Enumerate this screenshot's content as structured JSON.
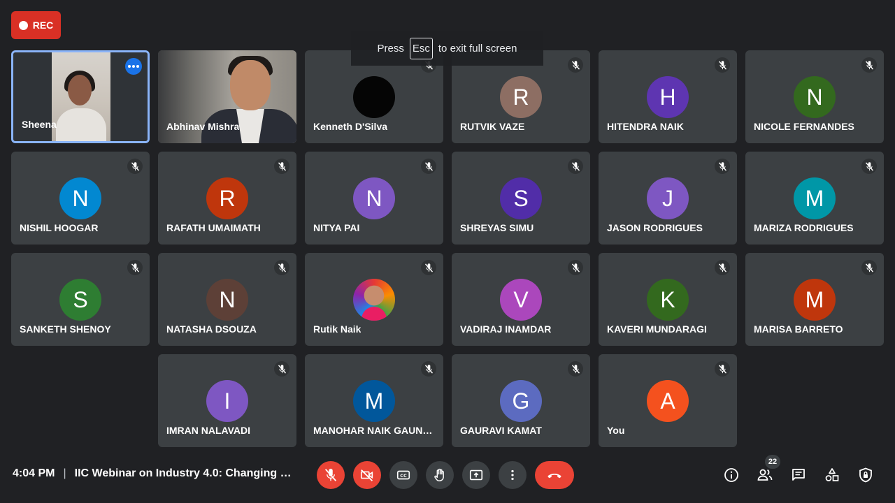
{
  "recording": {
    "label": "REC"
  },
  "toast": {
    "prefix": "Press",
    "key": "Esc",
    "suffix": "to exit full screen"
  },
  "participants": [
    {
      "name": "Sheena",
      "type": "video",
      "active": true
    },
    {
      "name": "Abhinav Mishra",
      "type": "video"
    },
    {
      "name": "Kenneth D'Silva",
      "initial": "",
      "color": "#050505",
      "muted": true
    },
    {
      "name": "RUTVIK VAZE",
      "initial": "R",
      "color": "#8d6e63",
      "muted": true
    },
    {
      "name": "HITENDRA NAIK",
      "initial": "H",
      "color": "#5e35b1",
      "muted": true
    },
    {
      "name": "NICOLE FERNANDES",
      "initial": "N",
      "color": "#33691e",
      "muted": true
    },
    {
      "name": "NISHIL HOOGAR",
      "initial": "N",
      "color": "#0288d1",
      "muted": true
    },
    {
      "name": "RAFATH UMAIMATH",
      "initial": "R",
      "color": "#bf360c",
      "muted": true
    },
    {
      "name": "NITYA PAI",
      "initial": "N",
      "color": "#7e57c2",
      "muted": true
    },
    {
      "name": "SHREYAS SIMU",
      "initial": "S",
      "color": "#512da8",
      "muted": true
    },
    {
      "name": "JASON RODRIGUES",
      "initial": "J",
      "color": "#7e57c2",
      "muted": true
    },
    {
      "name": "MARIZA RODRIGUES",
      "initial": "M",
      "color": "#0097a7",
      "muted": true
    },
    {
      "name": "SANKETH SHENOY",
      "initial": "S",
      "color": "#2e7d32",
      "muted": true
    },
    {
      "name": "NATASHA DSOUZA",
      "initial": "N",
      "color": "#5d4037",
      "muted": true
    },
    {
      "name": "Rutik Naik",
      "type": "picture",
      "muted": true
    },
    {
      "name": "VADIRAJ INAMDAR",
      "initial": "V",
      "color": "#ab47bc",
      "muted": true
    },
    {
      "name": "KAVERI MUNDARAGI",
      "initial": "K",
      "color": "#33691e",
      "muted": true
    },
    {
      "name": "MARISA BARRETO",
      "initial": "M",
      "color": "#bf360c",
      "muted": true
    },
    {
      "name": "IMRAN NALAVADI",
      "initial": "I",
      "color": "#7e57c2",
      "muted": true
    },
    {
      "name": "MANOHAR NAIK GAUNEKAR",
      "initial": "M",
      "color": "#01579b",
      "muted": true
    },
    {
      "name": "GAURAVI KAMAT",
      "initial": "G",
      "color": "#5c6bc0",
      "muted": true
    },
    {
      "name": "You",
      "initial": "A",
      "color": "#f4511e",
      "muted": true
    }
  ],
  "bottom_bar": {
    "time": "4:04 PM",
    "separator": "|",
    "meeting_title": "IIC Webinar on Industry 4.0: Changing s...",
    "people_count": "22"
  },
  "colors": {
    "background": "#202124",
    "tile": "#3c4043",
    "accent_red": "#ea4335",
    "active_border": "#8ab4f8"
  }
}
